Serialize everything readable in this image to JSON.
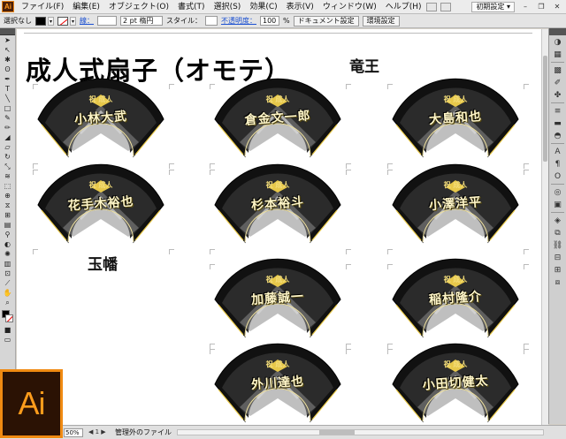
{
  "menubar": {
    "app_icon": "Ai",
    "items": [
      "ファイル(F)",
      "編集(E)",
      "オブジェクト(O)",
      "書式(T)",
      "選択(S)",
      "効果(C)",
      "表示(V)",
      "ウィンドウ(W)",
      "ヘルプ(H)"
    ],
    "workspace": "初期設定 ▾"
  },
  "controlbar": {
    "selection": "選択なし",
    "stroke_label": "線：",
    "stroke_weight": "2 pt 楕円",
    "style_label": "スタイル：",
    "opacity_label": "不透明度：",
    "opacity_value": "100",
    "percent": "%",
    "doc_settings": "ドキュメント設定",
    "prefs": "環境設定"
  },
  "canvas": {
    "title": "成人式扇子（オモテ）",
    "caption_ryuo": "竜王",
    "caption_gyokuhan": "玉幡",
    "fan_header": "祝 成人",
    "fans": [
      {
        "name": "小林大武"
      },
      {
        "name": "倉金文一郎"
      },
      {
        "name": "大島和也"
      },
      {
        "name": "花手木裕也"
      },
      {
        "name": "杉本裕斗"
      },
      {
        "name": "小澤洋平"
      },
      {
        "name": "加藤誠一"
      },
      {
        "name": "稲村隆介"
      },
      {
        "name": "外川達也"
      },
      {
        "name": "小田切健太"
      }
    ]
  },
  "statusbar": {
    "zoom": "50%",
    "nav": "◀ 1 ▶",
    "label": "管理外のファイル"
  },
  "logo": {
    "text": "Ai"
  },
  "colors": {
    "accent": "#f08a12",
    "fan_black": "#111111",
    "fan_gold": "#e7c84a"
  }
}
